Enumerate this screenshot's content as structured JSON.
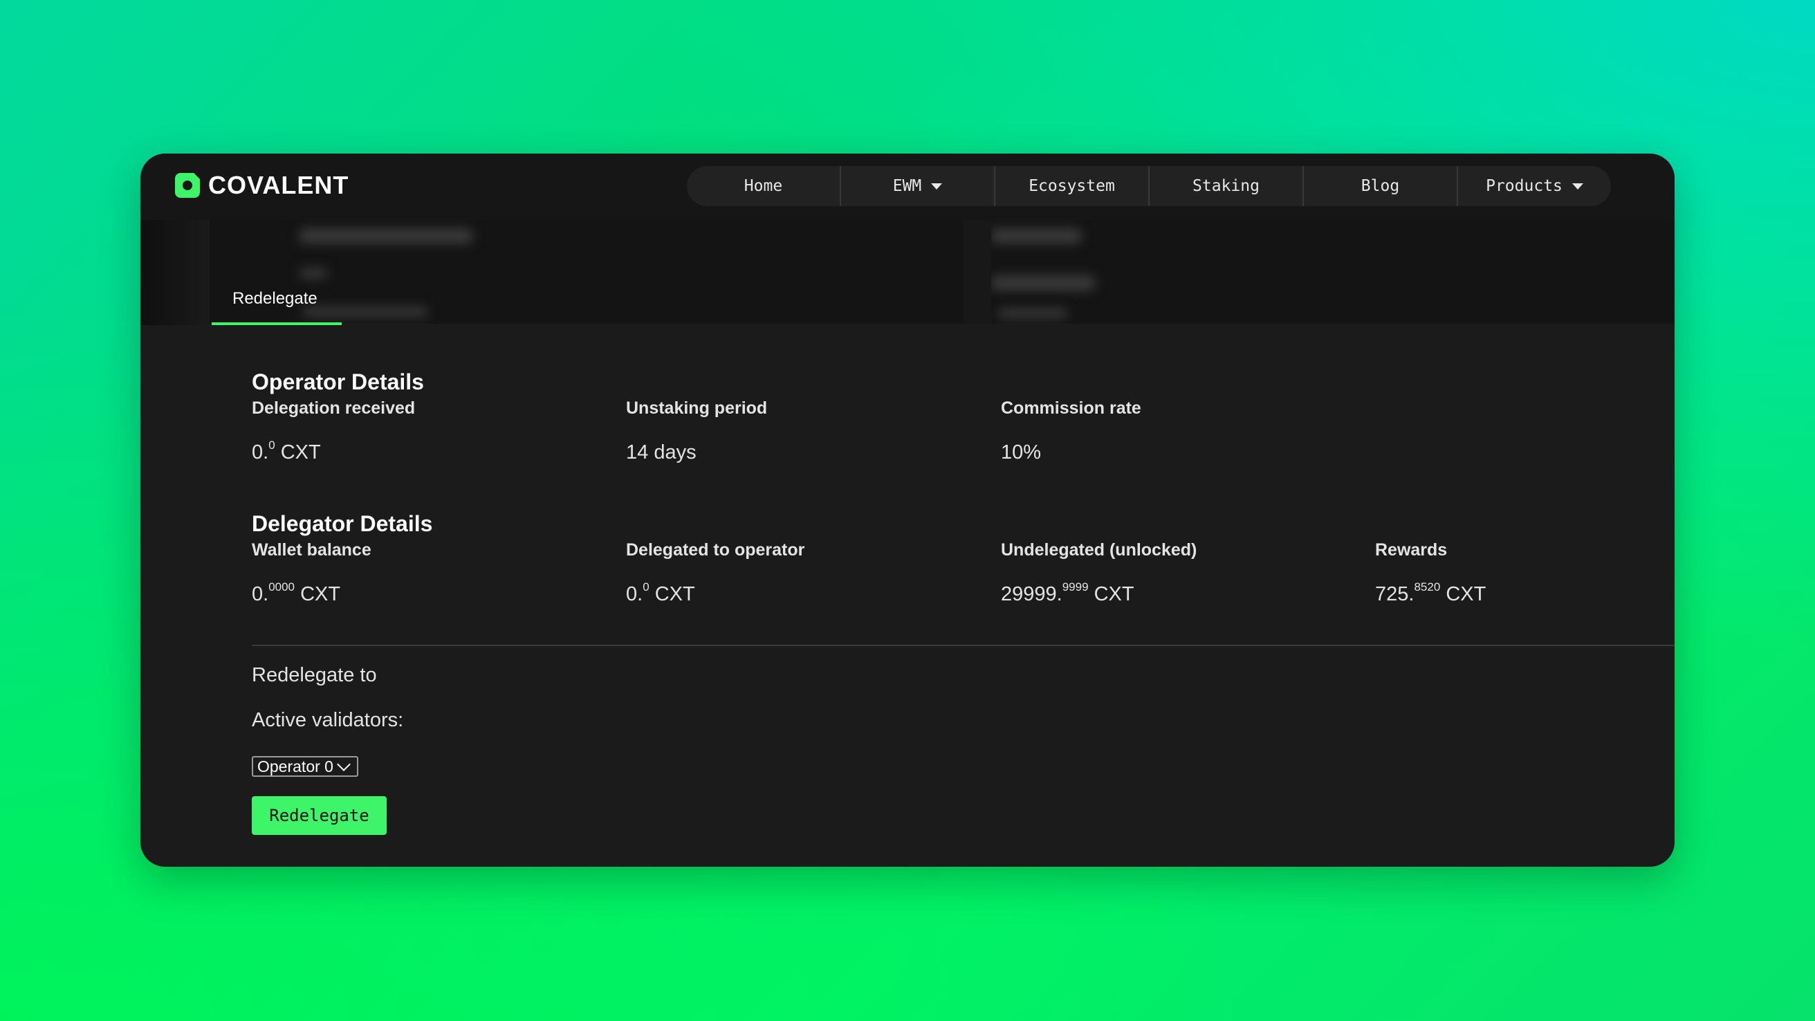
{
  "header": {
    "logo_text": "COVALENT",
    "nav": [
      {
        "label": "Home",
        "dropdown": false
      },
      {
        "label": "EWM",
        "dropdown": true
      },
      {
        "label": "Ecosystem",
        "dropdown": false
      },
      {
        "label": "Staking",
        "dropdown": false
      },
      {
        "label": "Blog",
        "dropdown": false
      },
      {
        "label": "Products",
        "dropdown": true
      }
    ]
  },
  "tab": {
    "label": "Redelegate"
  },
  "operator": {
    "title": "Operator Details",
    "fields": [
      {
        "label": "Delegation received",
        "value_int": "0.",
        "value_dec": "0",
        "unit": " CXT"
      },
      {
        "label": "Unstaking period",
        "value": "14 days"
      },
      {
        "label": "Commission rate",
        "value": "10%"
      }
    ]
  },
  "delegator": {
    "title": "Delegator Details",
    "fields": [
      {
        "label": "Wallet balance",
        "value_int": "0.",
        "value_dec": "0000",
        "unit": " CXT"
      },
      {
        "label": "Delegated to operator",
        "value_int": "0.",
        "value_dec": "0",
        "unit": " CXT"
      },
      {
        "label": "Undelegated (unlocked)",
        "value_int": "29999.",
        "value_dec": "9999",
        "unit": " CXT"
      },
      {
        "label": "Rewards",
        "value_int": "725.",
        "value_dec": "8520",
        "unit": " CXT"
      }
    ]
  },
  "redelegate": {
    "heading": "Redelegate to",
    "validators_label": "Active validators:",
    "selected_validator": "Operator 0",
    "button_label": "Redelegate"
  },
  "colors": {
    "accent": "#3ef56a",
    "window_bg": "#1b1b1b",
    "header_bg": "#161616"
  }
}
